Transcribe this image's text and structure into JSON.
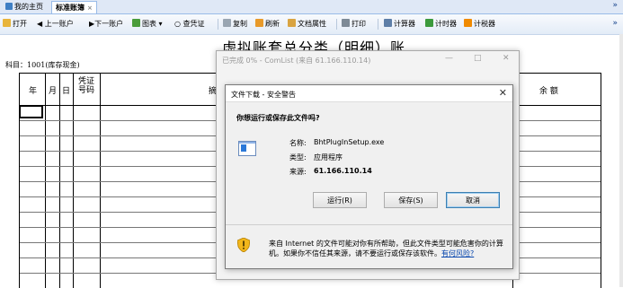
{
  "tabs": [
    {
      "label": "我的主页"
    },
    {
      "label": "标准账簿"
    }
  ],
  "tab_close": "×",
  "more_glyph": "»",
  "toolbar": {
    "open": "打开",
    "prev": "上一账户",
    "next": "下一账户",
    "chart": "图表",
    "check": "查凭证",
    "copy": "复制",
    "refresh": "刷新",
    "props": "文档属性",
    "print": "打印",
    "calculator": "计算器",
    "timer": "计时器",
    "calendar": "计税器"
  },
  "ledger": {
    "title": "虚拟账套总分类（明细）账",
    "subject": "科目：1001(库存现金)",
    "headers": {
      "year": "年",
      "month": "月",
      "day": "日",
      "voucher": "凭证号码",
      "summary": "摘",
      "balance": "余 额"
    }
  },
  "bg_dialog": {
    "title": "已完成 0% - ComList (来自 61.166.110.14)",
    "minimize": "—",
    "maximize": "□",
    "close": "✕"
  },
  "dialog": {
    "title": "文件下载 - 安全警告",
    "close": "✕",
    "question": "你想运行或保存此文件吗?",
    "name_label": "名称:",
    "name_value": "BhtPlugInSetup.exe",
    "type_label": "类型:",
    "type_value": "应用程序",
    "from_label": "来源:",
    "from_value": "61.166.110.14",
    "run_button": "运行(R)",
    "save_button": "保存(S)",
    "cancel_button": "取消",
    "warning_text": "来自 Internet 的文件可能对你有所帮助，但此文件类型可能危害你的计算机。如果你不信任其来源，请不要运行或保存该软件。",
    "risk_link": "有何风险?"
  },
  "colors": {
    "tabbar": "#dfe8f6",
    "accent": "#3c7fb1",
    "link": "#0645ad"
  }
}
